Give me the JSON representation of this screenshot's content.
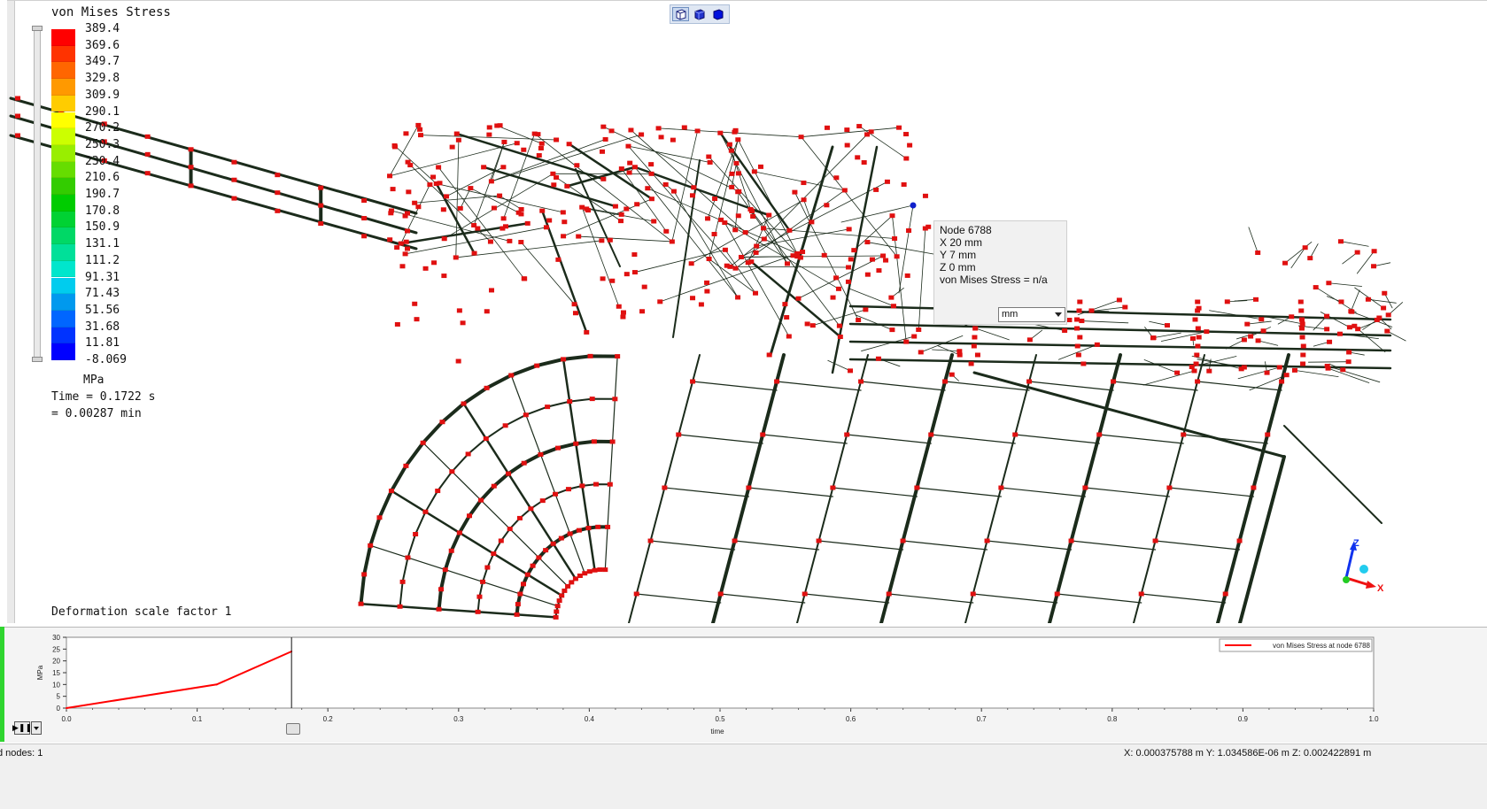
{
  "legend": {
    "title": "von Mises Stress",
    "values": [
      "389.4",
      "369.6",
      "349.7",
      "329.8",
      "309.9",
      "290.1",
      "270.2",
      "250.3",
      "230.4",
      "210.6",
      "190.7",
      "170.8",
      "150.9",
      "131.1",
      "111.2",
      "91.31",
      "71.43",
      "51.56",
      "31.68",
      "11.81",
      "-8.069"
    ],
    "colors": [
      "#ff0000",
      "#ff3300",
      "#ff6600",
      "#ff9900",
      "#ffcc00",
      "#ffff00",
      "#ccff00",
      "#99ee00",
      "#66dd00",
      "#33cc00",
      "#00cc00",
      "#00d233",
      "#00d866",
      "#00e099",
      "#00e6cc",
      "#00ccee",
      "#0099ee",
      "#0066ff",
      "#0033ff",
      "#0000ff"
    ],
    "units": "MPa",
    "time_line1": "Time = 0.1722 s",
    "time_line2": "= 0.00287 min"
  },
  "deformation_label": "Deformation scale factor 1",
  "tooltip": {
    "node": "Node  6788",
    "x": "X  20 mm",
    "y": "Y  7 mm",
    "z": "Z  0 mm",
    "stress": "von Mises Stress = n/a",
    "unit_selected": "mm"
  },
  "view_toolbar": {
    "icons": [
      "iso-view-icon",
      "front-view-icon",
      "solid-view-icon"
    ]
  },
  "triad": {
    "x_label": "X",
    "z_label": "Z"
  },
  "plot": {
    "legend": "von Mises Stress at node 6788",
    "xlabel": "time",
    "ylabel": "MPa",
    "x_ticks": [
      "0.0",
      "0.1",
      "0.2",
      "0.3",
      "0.4",
      "0.5",
      "0.6",
      "0.7",
      "0.8",
      "0.9",
      "1.0"
    ],
    "y_ticks": [
      "0",
      "5",
      "10",
      "15",
      "20",
      "25",
      "30"
    ],
    "cursor_time": 0.1722
  },
  "chart_data": {
    "type": "line",
    "title": "",
    "xlabel": "time",
    "ylabel": "MPa",
    "xlim": [
      0,
      1.0
    ],
    "ylim": [
      0,
      30
    ],
    "series": [
      {
        "name": "von Mises Stress at node 6788",
        "color": "#ff0000",
        "x": [
          0,
          0.115,
          0.1722
        ],
        "y": [
          0,
          10,
          24
        ]
      }
    ]
  },
  "status": {
    "left": "d nodes: 1",
    "right": "X: 0.000375788 m Y: 1.034586E-06 m Z: 0.002422891 m"
  }
}
